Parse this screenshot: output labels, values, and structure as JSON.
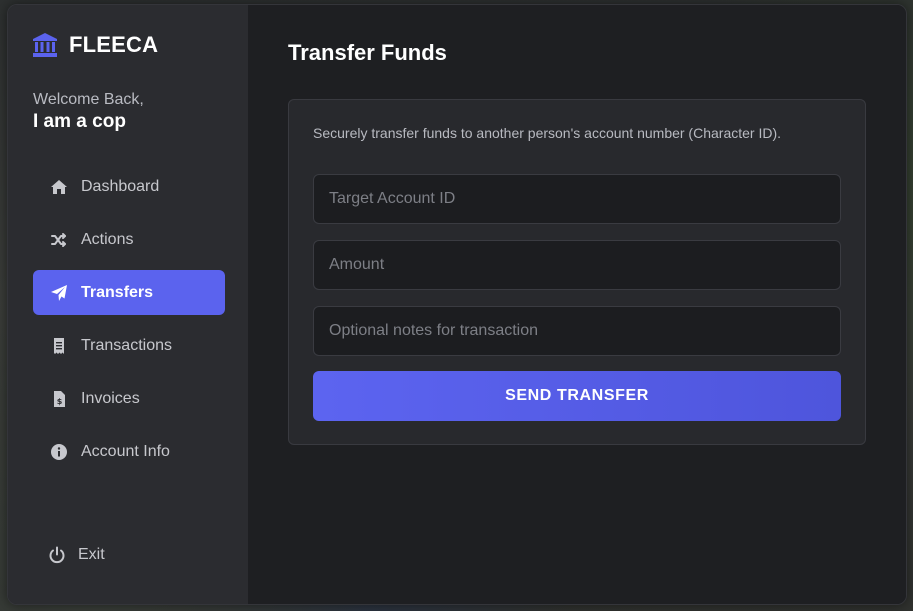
{
  "brand": {
    "name": "FLEECA",
    "icon": "bank-icon",
    "accent": "#5b63ee"
  },
  "welcome": {
    "label": "Welcome Back,",
    "name": "I am a cop"
  },
  "nav": {
    "items": [
      {
        "label": "Dashboard",
        "icon": "home-icon",
        "active": false
      },
      {
        "label": "Actions",
        "icon": "shuffle-icon",
        "active": false
      },
      {
        "label": "Transfers",
        "icon": "paper-plane-icon",
        "active": true
      },
      {
        "label": "Transactions",
        "icon": "receipt-icon",
        "active": false
      },
      {
        "label": "Invoices",
        "icon": "invoice-icon",
        "active": false
      },
      {
        "label": "Account Info",
        "icon": "info-icon",
        "active": false
      }
    ],
    "exit": {
      "label": "Exit",
      "icon": "power-icon"
    }
  },
  "main": {
    "title": "Transfer Funds",
    "description": "Securely transfer funds to another person's account number (Character ID).",
    "fields": {
      "target": {
        "placeholder": "Target Account ID",
        "value": ""
      },
      "amount": {
        "placeholder": "Amount",
        "value": ""
      },
      "notes": {
        "placeholder": "Optional notes for transaction",
        "value": ""
      }
    },
    "submit_label": "SEND TRANSFER"
  },
  "colors": {
    "sidebar_bg": "#2b2c30",
    "main_bg": "#1e1f22",
    "active_nav": "#5b63ee",
    "button": "#5c64f0"
  }
}
